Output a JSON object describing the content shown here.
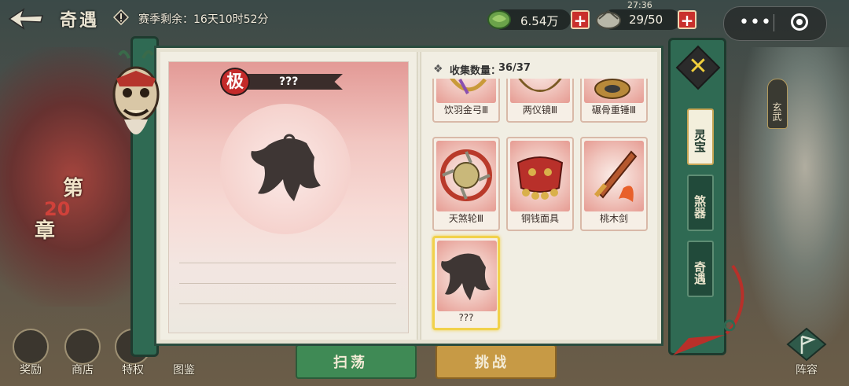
{
  "header": {
    "title": "奇遇",
    "season_text": "赛季剩余：16天10时52分",
    "coins_value": "6.54万",
    "stamina_value": "29/50",
    "stamina_timer": "27:36",
    "plus_glyph": "+"
  },
  "capsule": {
    "more_glyph": "•••"
  },
  "side": {
    "chapter_prefix": "第",
    "chapter_num": "20",
    "chapter_suffix": "章",
    "xuanwu_label": "玄武",
    "bottom_nav": [
      {
        "label": "奖励",
        "icon": "chest-icon"
      },
      {
        "label": "商店",
        "icon": "shop-icon"
      },
      {
        "label": "特权",
        "icon": "card-icon"
      },
      {
        "label": "图鉴",
        "icon": "book-icon"
      }
    ],
    "lineup_label": "阵容"
  },
  "background_buttons": {
    "left_label": "扫荡",
    "right_label": "挑战"
  },
  "detail": {
    "rank_badge": "极",
    "item_name": "???"
  },
  "collection": {
    "label": "收集数量：",
    "count": "36/37",
    "items": [
      {
        "name": "饮羽金弓Ⅲ",
        "art": "bow"
      },
      {
        "name": "两仪镜Ⅲ",
        "art": "mirror"
      },
      {
        "name": "碾骨重锤Ⅲ",
        "art": "hammer"
      },
      {
        "name": "天煞轮Ⅲ",
        "art": "wheel"
      },
      {
        "name": "铜钱面具",
        "art": "coin-mask"
      },
      {
        "name": "桃木剑",
        "art": "peach-sword"
      },
      {
        "name": "???",
        "art": "silhouette"
      }
    ],
    "selected_index": 6
  },
  "tabs": [
    {
      "label": "灵宝",
      "active": true
    },
    {
      "label": "煞器",
      "active": false
    },
    {
      "label": "奇遇",
      "active": false
    }
  ],
  "close_glyph": "✕",
  "colors": {
    "accent_green": "#2f6a53",
    "tab_gold": "#f0cf3c",
    "badge_red": "#c42a2a"
  }
}
